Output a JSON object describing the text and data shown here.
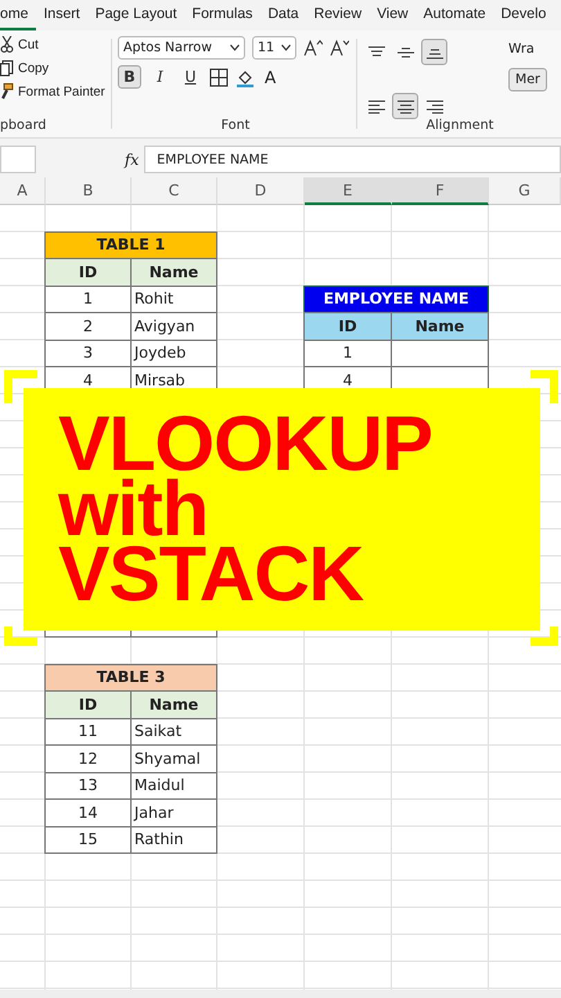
{
  "ribbon_tabs": [
    {
      "label": "ome",
      "selected": true
    },
    {
      "label": "Insert",
      "selected": false
    },
    {
      "label": "Page Layout",
      "selected": false
    },
    {
      "label": "Formulas",
      "selected": false
    },
    {
      "label": "Data",
      "selected": false
    },
    {
      "label": "Review",
      "selected": false
    },
    {
      "label": "View",
      "selected": false
    },
    {
      "label": "Automate",
      "selected": false
    },
    {
      "label": "Develo",
      "selected": false
    }
  ],
  "clipboard": {
    "items": [
      {
        "kind": "cut",
        "label": "Cut"
      },
      {
        "kind": "copy",
        "label": "Copy"
      },
      {
        "kind": "painter",
        "label": "Format Painter"
      }
    ],
    "group_label": "pboard"
  },
  "font": {
    "font_name": "Aptos Narrow",
    "font_size": "11",
    "bold": true,
    "italic": false,
    "underline": false,
    "bold_label": "B",
    "italic_label": "I",
    "underline_label": "U",
    "font_color_label": "A",
    "group_label": "Font"
  },
  "alignment": {
    "align_buttons": [
      {
        "kind": "top",
        "selected": false
      },
      {
        "kind": "middle",
        "selected": false
      },
      {
        "kind": "bottom",
        "selected": true
      },
      {
        "kind": "left",
        "selected": false
      },
      {
        "kind": "center",
        "selected": true
      },
      {
        "kind": "right",
        "selected": false
      }
    ],
    "wrap_label": "Wra",
    "merge_label": "Mer",
    "group_label": "Alignment"
  },
  "formula_bar": {
    "fx_label": "fx",
    "formula": "EMPLOYEE NAME"
  },
  "columns": [
    {
      "label": "A",
      "selected": false
    },
    {
      "label": "B",
      "selected": false
    },
    {
      "label": "C",
      "selected": false
    },
    {
      "label": "D",
      "selected": false
    },
    {
      "label": "E",
      "selected": true
    },
    {
      "label": "F",
      "selected": true
    },
    {
      "label": "G",
      "selected": false
    }
  ],
  "tables": [
    {
      "title": "TABLE 1",
      "color": "#ffc000",
      "headers": [
        "ID",
        "Name"
      ],
      "rows": [
        [
          "1",
          "Rohit"
        ],
        [
          "2",
          "Avigyan"
        ],
        [
          "3",
          "Joydeb"
        ],
        [
          "4",
          "Mirsab"
        ]
      ]
    },
    {
      "title": "TABLE 3",
      "color": "#f8cbad",
      "headers": [
        "ID",
        "Name"
      ],
      "rows": [
        [
          "11",
          "Saikat"
        ],
        [
          "12",
          "Shyamal"
        ],
        [
          "13",
          "Maidul"
        ],
        [
          "14",
          "Jahar"
        ],
        [
          "15",
          "Rathin"
        ]
      ]
    }
  ],
  "lookup": {
    "title": "EMPLOYEE NAME",
    "headers": [
      "ID",
      "Name"
    ],
    "ids": [
      "1",
      "4"
    ]
  },
  "banner": {
    "lines": [
      "VLOOKUP",
      "with",
      "VSTACK"
    ]
  }
}
